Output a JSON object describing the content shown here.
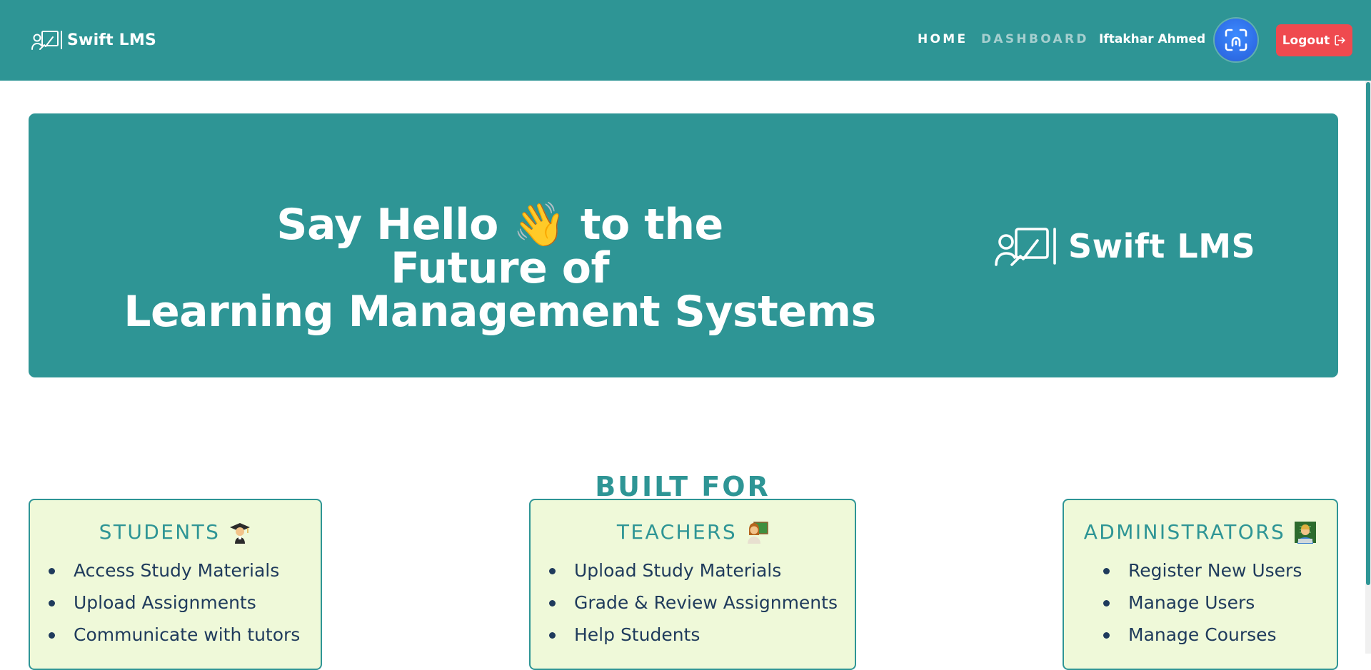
{
  "navbar": {
    "brand_name": "Swift LMS",
    "links": {
      "home": "HOME",
      "dashboard": "DASHBOARD"
    },
    "user_name": "Iftakhar Ahmed",
    "logout_label": "Logout"
  },
  "hero": {
    "title_line1": "Say Hello 👋 to the",
    "title_line2": "Future of",
    "title_line3": "Learning Management Systems",
    "logo_text": "Swift LMS"
  },
  "built_for": {
    "heading": "BUILT FOR",
    "cards": [
      {
        "title": "STUDENTS",
        "icon": "student-emoji",
        "items": [
          "Access Study Materials",
          "Upload Assignments",
          "Communicate with tutors"
        ]
      },
      {
        "title": "TEACHERS",
        "icon": "teacher-emoji",
        "items": [
          "Upload Study Materials",
          "Grade & Review Assignments",
          "Help Students"
        ]
      },
      {
        "title": "ADMINISTRATORS",
        "icon": "technologist-emoji",
        "items": [
          "Register New Users",
          "Manage Users",
          "Manage Courses"
        ]
      }
    ]
  },
  "colors": {
    "primary": "#2e9595",
    "muted_link": "#a6cfcf",
    "logout": "#ef4a4f",
    "card_bg": "#eff9d9",
    "list_text": "#1f3b5c",
    "avatar": "#2f6fe8"
  }
}
